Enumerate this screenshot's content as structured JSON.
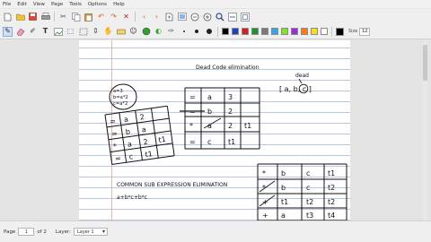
{
  "menu": [
    "File",
    "Edit",
    "View",
    "Page",
    "Tools",
    "Options",
    "Help"
  ],
  "toolbar1": {
    "icons": [
      "new-page",
      "open",
      "save",
      "print",
      "cut",
      "copy",
      "paste",
      "undo",
      "redo",
      "delete",
      "page-back",
      "page-forward",
      "page-new",
      "fullscreen",
      "zoom-out",
      "zoom-in",
      "zoom-search",
      "zoom-fit",
      "zoom-page"
    ]
  },
  "toolbar2": {
    "colors": [
      "#000000",
      "#1f3fbf",
      "#cc2222",
      "#1f8f2f",
      "#7a7a7a",
      "#2ea8e6",
      "#7fe033",
      "#9b2fd1",
      "#ff7a1a",
      "#ffde1f",
      "#ffffff"
    ],
    "size_label": "Size",
    "size_value": "12"
  },
  "note": {
    "title": "Dead Code elimination",
    "bubble_lines": [
      "a=3",
      "b=a*2",
      "c=a*2"
    ],
    "annotation_top": "dead",
    "annotation_list": "[ a, b, c ]",
    "left_table": [
      [
        "=",
        "a",
        "2",
        ""
      ],
      [
        "=",
        "b",
        "a",
        ""
      ],
      [
        "*",
        "a",
        "2",
        "t1"
      ],
      [
        "=",
        "c",
        "t1",
        ""
      ]
    ],
    "mid_table": [
      [
        "=",
        "a",
        "3",
        ""
      ],
      [
        "=",
        "b",
        "2",
        ""
      ],
      [
        "*",
        "a",
        "2",
        "t1"
      ],
      [
        "=",
        "c",
        "t1",
        ""
      ]
    ],
    "section2": "COMMON SUB EXPRESSION ELIMINATION",
    "expression": "a+b*c+b*c",
    "right_table": [
      [
        "*",
        "b",
        "c",
        "t1"
      ],
      [
        "*",
        "b",
        "c",
        "t2"
      ],
      [
        "+",
        "t1",
        "t2",
        "t2"
      ],
      [
        "+",
        "a",
        "t3",
        "t4"
      ]
    ]
  },
  "status": {
    "page_label": "Page",
    "page_value": "1",
    "of_label": "of 2",
    "layer_label": "Layer:",
    "layer_value": "Layer 1"
  }
}
